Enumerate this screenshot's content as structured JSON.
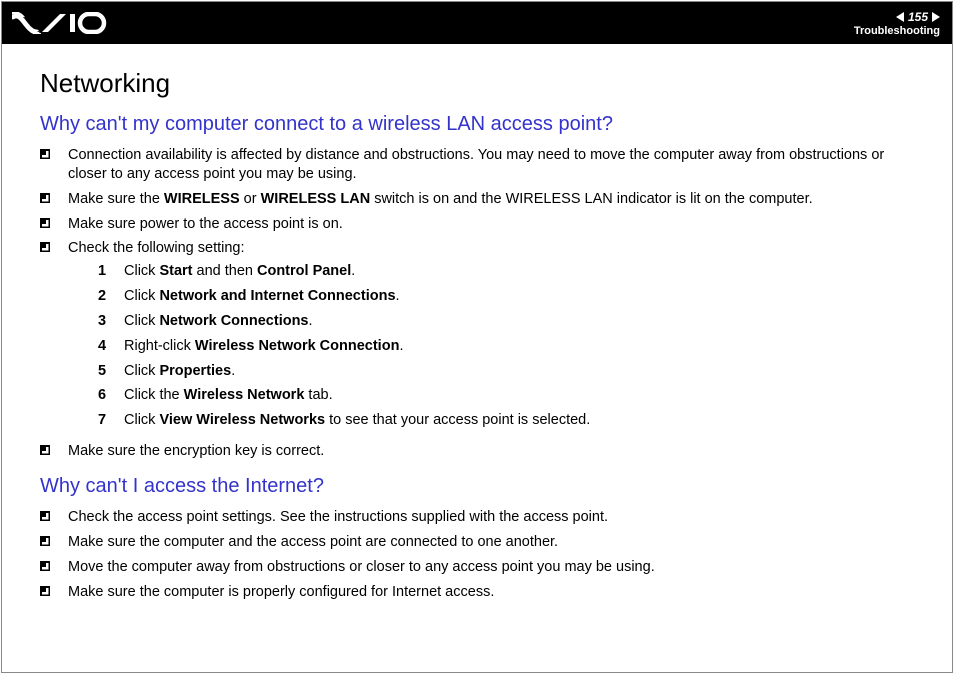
{
  "header": {
    "page_number": "155",
    "section": "Troubleshooting"
  },
  "title": "Networking",
  "q1": {
    "heading": "Why can't my computer connect to a wireless LAN access point?",
    "b1": "Connection availability is affected by distance and obstructions. You may need to move the computer away from obstructions or closer to any access point you may be using.",
    "b2_pre": "Make sure the ",
    "b2_bold1": "WIRELESS",
    "b2_mid1": " or ",
    "b2_bold2": "WIRELESS LAN",
    "b2_post": " switch is on and the WIRELESS LAN indicator is lit on the computer.",
    "b3": "Make sure power to the access point is on.",
    "b4": "Check the following setting:",
    "steps": {
      "s1_pre": "Click ",
      "s1_b1": "Start",
      "s1_mid": " and then ",
      "s1_b2": "Control Panel",
      "s1_post": ".",
      "s2_pre": "Click ",
      "s2_b1": "Network and Internet Connections",
      "s2_post": ".",
      "s3_pre": "Click ",
      "s3_b1": "Network Connections",
      "s3_post": ".",
      "s4_pre": "Right-click ",
      "s4_b1": "Wireless Network Connection",
      "s4_post": ".",
      "s5_pre": "Click ",
      "s5_b1": "Properties",
      "s5_post": ".",
      "s6_pre": "Click the ",
      "s6_b1": "Wireless Network",
      "s6_post": " tab.",
      "s7_pre": "Click ",
      "s7_b1": "View Wireless Networks",
      "s7_post": " to see that your access point is selected."
    },
    "b5": "Make sure the encryption key is correct."
  },
  "q2": {
    "heading": "Why can't I access the Internet?",
    "b1": "Check the access point settings. See the instructions supplied with the access point.",
    "b2": "Make sure the computer and the access point are connected to one another.",
    "b3": "Move the computer away from obstructions or closer to any access point you may be using.",
    "b4": "Make sure the computer is properly configured for Internet access."
  }
}
